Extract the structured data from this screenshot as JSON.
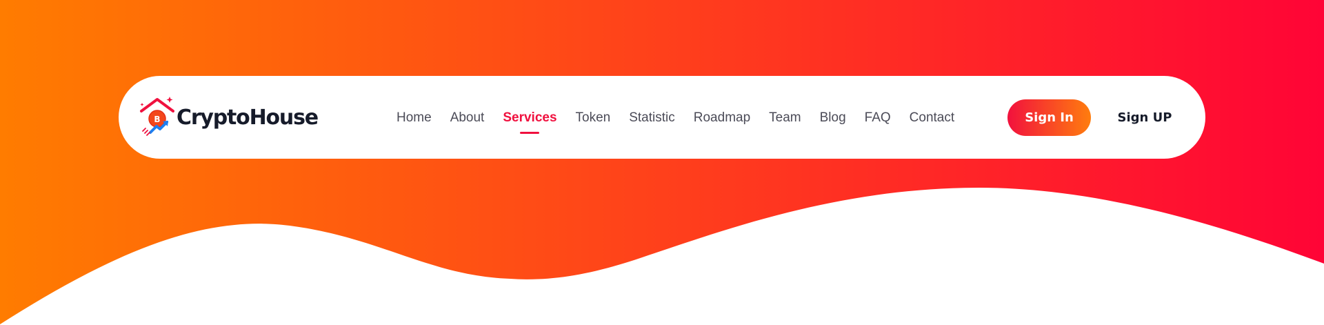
{
  "colors": {
    "gradient_start": "#ff7c00",
    "gradient_end": "#ff0436",
    "accent": "#f0103e",
    "text_dark": "#161b2a",
    "nav_text": "#4b4b57",
    "background": "#ffffff"
  },
  "brand": {
    "name": "CryptoHouse",
    "logo_icon": "crypto-house-logo-icon",
    "logo_coin_letter": "B"
  },
  "nav": {
    "items": [
      {
        "label": "Home"
      },
      {
        "label": "About"
      },
      {
        "label": "Services",
        "active": true
      },
      {
        "label": "Token"
      },
      {
        "label": "Statistic"
      },
      {
        "label": "Roadmap"
      },
      {
        "label": "Team"
      },
      {
        "label": "Blog"
      },
      {
        "label": "FAQ"
      },
      {
        "label": "Contact"
      }
    ]
  },
  "actions": {
    "sign_in": "Sign In",
    "sign_up": "Sign UP"
  }
}
